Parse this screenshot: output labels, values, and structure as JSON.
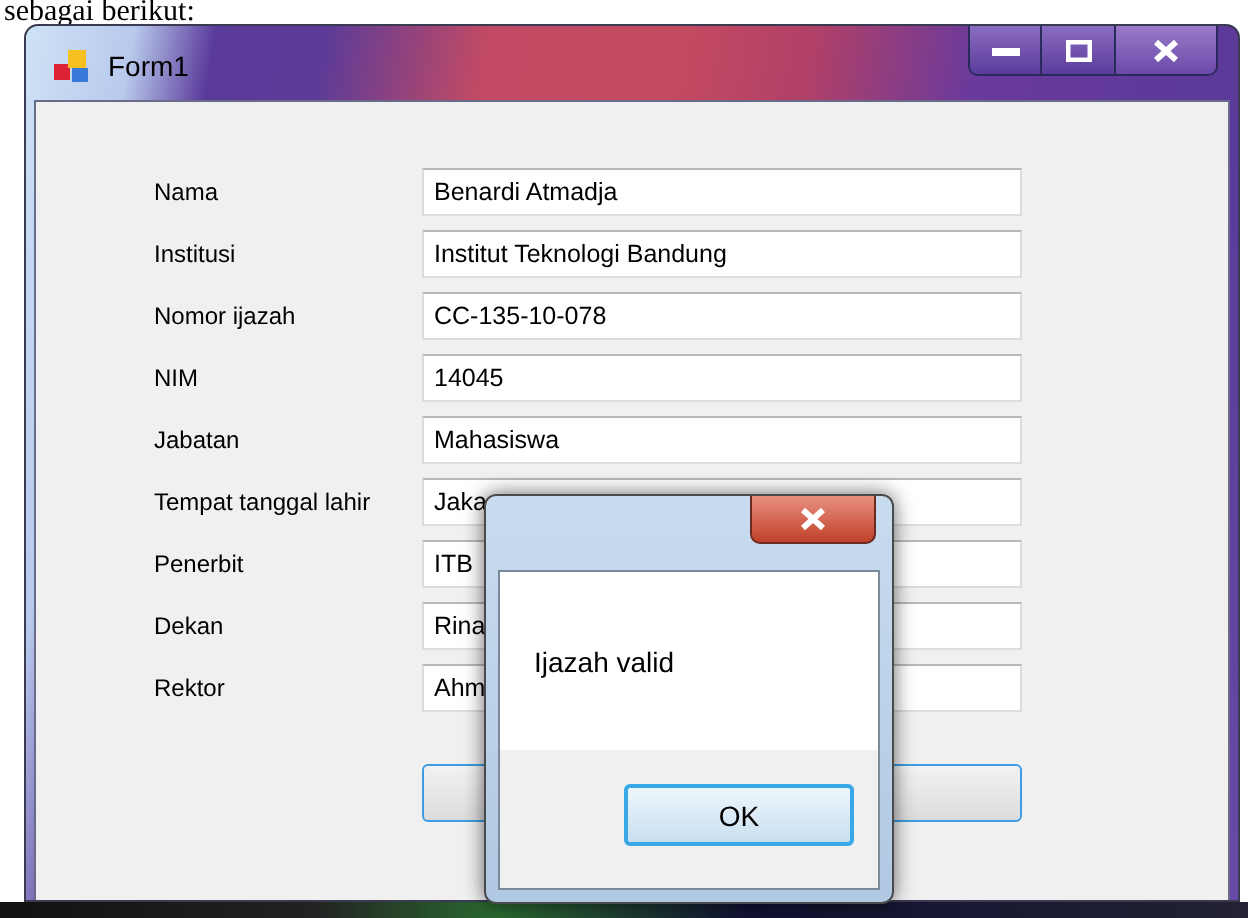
{
  "document_text": "sebagai berikut:",
  "window": {
    "title": "Form1",
    "buttons": [
      {
        "kind": "minimize"
      },
      {
        "kind": "maximize"
      },
      {
        "kind": "close"
      }
    ]
  },
  "fields": [
    {
      "label": "Nama",
      "value": "Benardi Atmadja"
    },
    {
      "label": "Institusi",
      "value": "Institut Teknologi Bandung"
    },
    {
      "label": "Nomor ijazah",
      "value": "CC-135-10-078"
    },
    {
      "label": "NIM",
      "value": "14045"
    },
    {
      "label": "Jabatan",
      "value": "Mahasiswa"
    },
    {
      "label": "Tempat tanggal lahir",
      "value": "Jaka"
    },
    {
      "label": "Penerbit",
      "value": "ITB"
    },
    {
      "label": "Dekan",
      "value": "Rina"
    },
    {
      "label": "Rektor",
      "value": "Ahm"
    }
  ],
  "dialog": {
    "message": "Ijazah valid",
    "button": "OK"
  }
}
